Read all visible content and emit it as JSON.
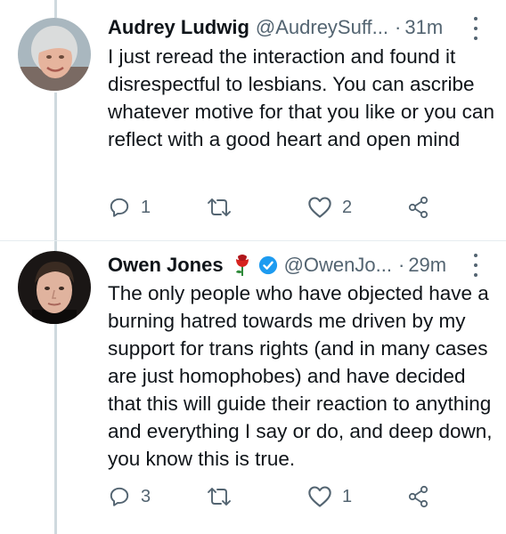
{
  "tweets": [
    {
      "name": "Audrey Ludwig",
      "handle": "@AudreySuff...",
      "dot": "·",
      "time": "31m",
      "text": "I just reread the interaction and found it disrespectful to lesbians. You can ascribe whatever motive for that you like or you can reflect with a good heart and open mind",
      "replies": "1",
      "retweets": "",
      "likes": "2",
      "avatar_icon": "profile-photo-woman",
      "colors": {
        "avatar_bg": "#a9b7bf",
        "hair": "#dadcdc",
        "face": "#e6b49d"
      }
    },
    {
      "name": "Owen Jones",
      "badge_emoji": "rose",
      "verified": true,
      "handle": "@OwenJo...",
      "dot": "·",
      "time": "29m",
      "text": "The only people who have objected have a burning hatred towards me driven by my support for trans rights (and in many cases are just homophobes) and have decided that this will guide their reaction to anything and everything I say or do, and deep down, you know this is true.",
      "replies": "3",
      "retweets": "",
      "likes": "1",
      "avatar_icon": "profile-photo-man",
      "colors": {
        "avatar_bg": "#1a1615",
        "hair": "#3a2b22",
        "face": "#e0b39e"
      }
    }
  ],
  "icons": {
    "reply": "reply-bubble-icon",
    "retweet": "retweet-arrows-icon",
    "like": "heart-icon",
    "share": "share-icon",
    "more": "more-options-icon"
  },
  "colors": {
    "text": "#0f1419",
    "muted": "#536471",
    "thread_line": "#cfd9de",
    "verified": "#1d9bf0",
    "rose": "#d6231f"
  }
}
